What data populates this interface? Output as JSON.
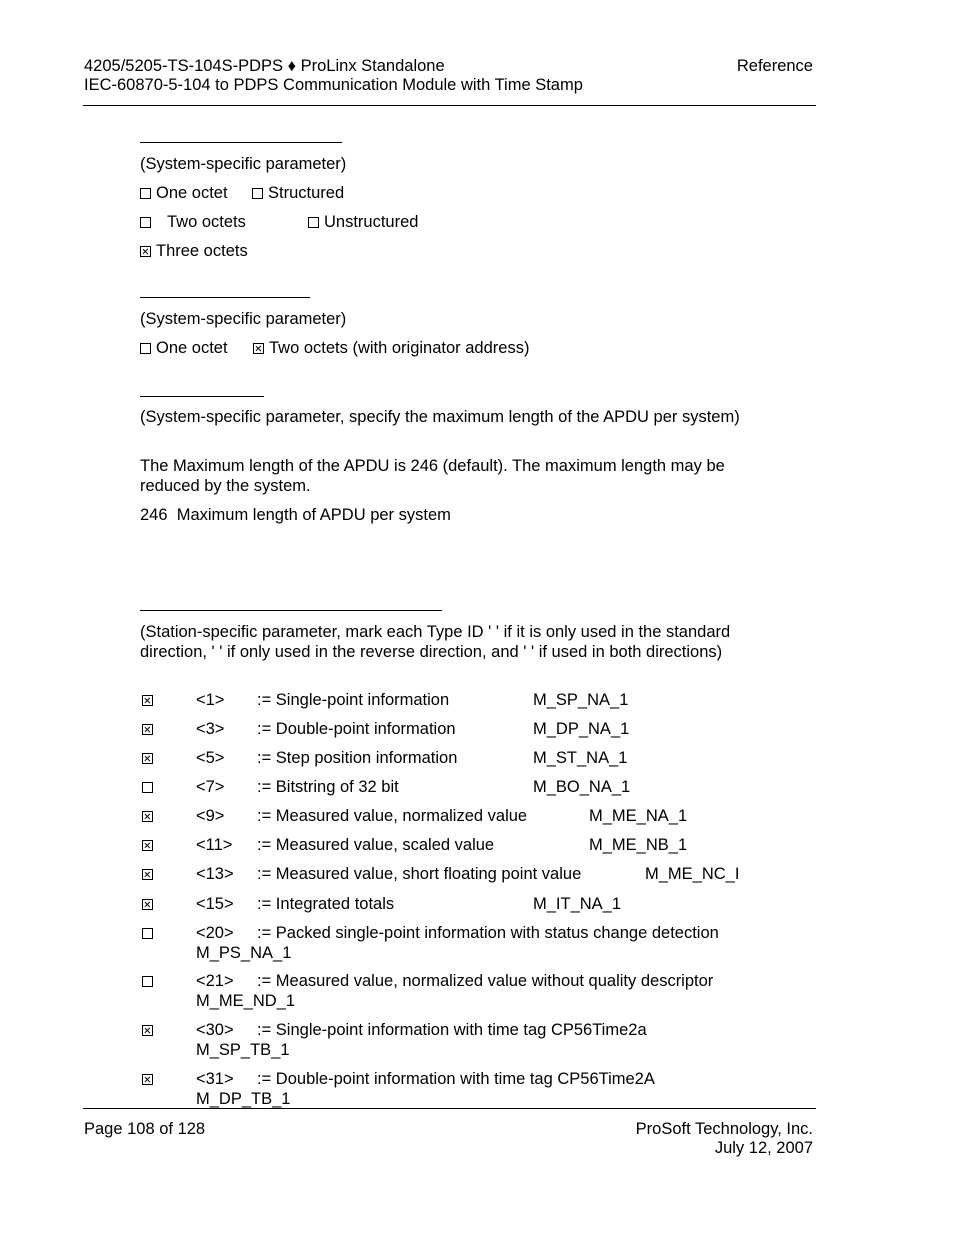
{
  "header": {
    "doc_line1": "4205/5205-TS-104S-PDPS ♦ ProLinx Standalone",
    "doc_line2": "IEC-60870-5-104 to PDPS Communication Module with Time Stamp",
    "section": "Reference"
  },
  "section1": {
    "note": "(System-specific parameter)",
    "options": [
      {
        "label": "One octet",
        "checked": false
      },
      {
        "label": "Structured",
        "checked": false
      },
      {
        "label": "Two octets",
        "checked": false
      },
      {
        "label": "Unstructured",
        "checked": false
      },
      {
        "label": "Three octets",
        "checked": true
      }
    ]
  },
  "section2": {
    "note": "(System-specific parameter)",
    "options": [
      {
        "label": "One octet",
        "checked": false
      },
      {
        "label": "Two octets (with originator address)",
        "checked": true
      }
    ]
  },
  "section3": {
    "note": "(System-specific parameter, specify the maximum length of the APDU per system)",
    "text": "The Maximum length of the APDU is 246 (default). The maximum length may be reduced by the system.",
    "value": "246",
    "value_label": "Maximum length of APDU per system"
  },
  "section4": {
    "note": "(Station-specific parameter, mark each Type ID '   ' if it is only used in the standard direction, '   ' if only used in the reverse direction, and '   ' if used in both directions)",
    "type_ids": [
      {
        "id": "<1>",
        "desc": ":= Single-point information",
        "code": "M_SP_NA_1",
        "checked": true
      },
      {
        "id": "<3>",
        "desc": ":= Double-point information",
        "code": "M_DP_NA_1",
        "checked": true
      },
      {
        "id": "<5>",
        "desc": ":= Step position information",
        "code": "M_ST_NA_1",
        "checked": true
      },
      {
        "id": "<7>",
        "desc": ":= Bitstring of 32 bit",
        "code": "M_BO_NA_1",
        "checked": false
      },
      {
        "id": "<9>",
        "desc": ":= Measured value, normalized value",
        "code": "M_ME_NA_1",
        "checked": true
      },
      {
        "id": "<11>",
        "desc": ":= Measured value, scaled value",
        "code": "M_ME_NB_1",
        "checked": true
      },
      {
        "id": "<13>",
        "desc": ":= Measured value, short floating point value",
        "code": "M_ME_NC_I",
        "checked": true
      },
      {
        "id": "<15>",
        "desc": ":= Integrated totals",
        "code": "M_IT_NA_1",
        "checked": true
      },
      {
        "id": "<20>",
        "desc": ":= Packed single-point information with status change detection",
        "code": "M_PS_NA_1",
        "checked": false
      },
      {
        "id": "<21>",
        "desc": ":= Measured value, normalized value without quality descriptor",
        "code": "M_ME_ND_1",
        "checked": false
      },
      {
        "id": "<30>",
        "desc": ":= Single-point information with time tag CP56Time2a",
        "code": "M_SP_TB_1",
        "checked": true
      },
      {
        "id": "<31>",
        "desc": ":= Double-point information with time tag CP56Time2A",
        "code": "M_DP_TB_1",
        "checked": true
      }
    ]
  },
  "footer": {
    "page": "Page 108 of 128",
    "company": "ProSoft Technology, Inc.",
    "date": "July 12, 2007"
  }
}
